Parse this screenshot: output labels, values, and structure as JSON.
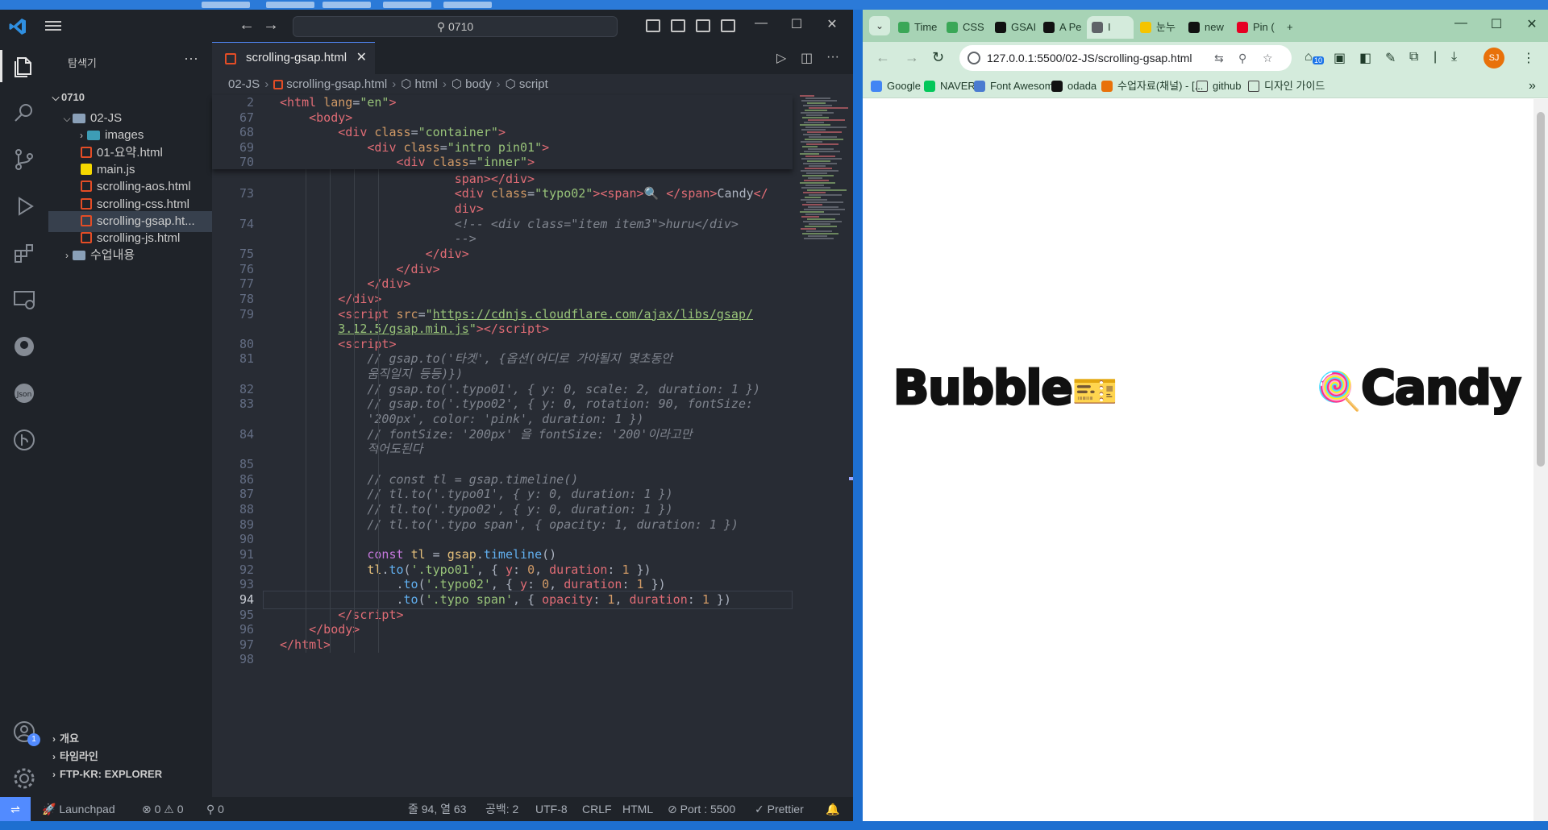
{
  "vscode": {
    "search": "0710",
    "sidebar": {
      "title": "탐색기",
      "workspace": "0710",
      "tree": [
        {
          "label": "02-JS",
          "type": "folder-open"
        },
        {
          "label": "images",
          "type": "folder-img"
        },
        {
          "label": "01-요약.html",
          "type": "html"
        },
        {
          "label": "main.js",
          "type": "js"
        },
        {
          "label": "scrolling-aos.html",
          "type": "html"
        },
        {
          "label": "scrolling-css.html",
          "type": "html"
        },
        {
          "label": "scrolling-gsap.ht...",
          "type": "html",
          "selected": true
        },
        {
          "label": "scrolling-js.html",
          "type": "html"
        },
        {
          "label": "수업내용",
          "type": "folder"
        }
      ],
      "bottom_sections": [
        "개요",
        "타임라인",
        "FTP-KR: EXPLORER"
      ]
    },
    "tab": {
      "label": "scrolling-gsap.html"
    },
    "breadcrumb": [
      "02-JS",
      "scrolling-gsap.html",
      "html",
      "body",
      "script"
    ],
    "accounts_badge": "1",
    "status": {
      "launchpad": "Launchpad",
      "errors": "0",
      "warnings": "0",
      "ports": "0",
      "cursor": "줄 94, 열 63",
      "spaces": "공백: 2",
      "encoding": "UTF-8",
      "eol": "CRLF",
      "language": "HTML",
      "port": "Port : 5500",
      "prettier": "Prettier"
    },
    "code_lines": [
      {
        "n": "2",
        "sticky": true,
        "html": "<span class=\"tag\">&lt;html</span> <span class=\"attr\">lang</span>=<span class=\"str\">\"en\"</span><span class=\"tag\">&gt;</span>"
      },
      {
        "n": "67",
        "sticky": true,
        "html": "    <span class=\"tag\">&lt;body&gt;</span>"
      },
      {
        "n": "68",
        "sticky": true,
        "html": "        <span class=\"tag\">&lt;div</span> <span class=\"attr\">class</span>=<span class=\"str\">\"container\"</span><span class=\"tag\">&gt;</span>"
      },
      {
        "n": "69",
        "sticky": true,
        "html": "            <span class=\"tag\">&lt;div</span> <span class=\"attr\">class</span>=<span class=\"str\">\"intro pin01\"</span><span class=\"tag\">&gt;</span>"
      },
      {
        "n": "70",
        "sticky": true,
        "html": "                <span class=\"tag\">&lt;div</span> <span class=\"attr\">class</span>=<span class=\"str\">\"inner\"</span><span class=\"tag\">&gt;</span>"
      },
      {
        "n": "",
        "html": "                        <span class=\"plain\">span&gt;&lt;/div&gt;</span>"
      },
      {
        "n": "",
        "html": "                        <span class=\"tag\">span&gt;&lt;/div&gt;</span>"
      },
      {
        "n": "73",
        "html": "                        <span class=\"tag\">&lt;div</span> <span class=\"attr\">class</span>=<span class=\"str\">\"typo02\"</span><span class=\"tag\">&gt;&lt;span&gt;</span>🔍 <span class=\"tag\">&lt;/span&gt;</span><span class=\"plain\">Candy</span><span class=\"tag\">&lt;/</span>"
      },
      {
        "n": "",
        "html": "                        <span class=\"tag\">div&gt;</span>"
      },
      {
        "n": "74",
        "html": "                        <span class=\"cmt\">&lt;!-- &lt;div class=\"item item3\"&gt;huru&lt;/div&gt;</span>"
      },
      {
        "n": "",
        "html": "                        <span class=\"cmt\">--&gt;</span>"
      },
      {
        "n": "75",
        "html": "                    <span class=\"tag\">&lt;/div&gt;</span>"
      },
      {
        "n": "76",
        "html": "                <span class=\"tag\">&lt;/div&gt;</span>"
      },
      {
        "n": "77",
        "html": "            <span class=\"tag\">&lt;/div&gt;</span>"
      },
      {
        "n": "78",
        "html": "        <span class=\"tag\">&lt;/div&gt;</span>"
      },
      {
        "n": "79",
        "html": "        <span class=\"tag\">&lt;script</span> <span class=\"attr\">src</span>=<span class=\"str\">\"</span><span class=\"link\">https://cdnjs.cloudflare.com/ajax/libs/gsap/</span>"
      },
      {
        "n": "",
        "html": "        <span class=\"link\">3.12.5/gsap.min.js</span><span class=\"str\">\"</span><span class=\"tag\">&gt;&lt;/script&gt;</span>"
      },
      {
        "n": "80",
        "html": "        <span class=\"tag\">&lt;script&gt;</span>"
      },
      {
        "n": "81",
        "html": "            <span class=\"cmt\">// gsap.to('타겟', {옵션(어디로 가야될지 몇초동안</span>"
      },
      {
        "n": "",
        "html": "            <span class=\"cmt\">움직일지 등등)})</span>"
      },
      {
        "n": "82",
        "html": "            <span class=\"cmt\">// gsap.to('.typo01', { y: 0, scale: 2, duration: 1 })</span>"
      },
      {
        "n": "83",
        "html": "            <span class=\"cmt\">// gsap.to('.typo02', { y: 0, rotation: 90, fontSize:</span>"
      },
      {
        "n": "",
        "html": "            <span class=\"cmt\">'200px', color: 'pink', duration: 1 })</span>"
      },
      {
        "n": "84",
        "html": "            <span class=\"cmt\">// fontSize: '200px' 을 fontSize: '200'이라고만</span>"
      },
      {
        "n": "",
        "html": "            <span class=\"cmt\">적어도된다</span>"
      },
      {
        "n": "85",
        "html": ""
      },
      {
        "n": "86",
        "html": "            <span class=\"cmt\">// const tl = gsap.timeline()</span>"
      },
      {
        "n": "87",
        "html": "            <span class=\"cmt\">// tl.to('.typo01', { y: 0, duration: 1 })</span>"
      },
      {
        "n": "88",
        "html": "            <span class=\"cmt\">// tl.to('.typo02', { y: 0, duration: 1 })</span>"
      },
      {
        "n": "89",
        "html": "            <span class=\"cmt\">// tl.to('.typo span', { opacity: 1, duration: 1 })</span>"
      },
      {
        "n": "90",
        "html": ""
      },
      {
        "n": "91",
        "html": "            <span class=\"kw\">const</span> <span class=\"var\">tl</span> <span class=\"plain\">=</span> <span class=\"var\">gsap</span><span class=\"plain\">.</span><span class=\"fn\">timeline</span><span class=\"plain\">()</span>"
      },
      {
        "n": "92",
        "html": "            <span class=\"var\">tl</span><span class=\"plain\">.</span><span class=\"fn\">to</span><span class=\"plain\">(</span><span class=\"str\">'.typo01'</span><span class=\"plain\">, { </span><span class=\"tag\">y</span><span class=\"plain\">: </span><span class=\"num\">0</span><span class=\"plain\">, </span><span class=\"tag\">duration</span><span class=\"plain\">: </span><span class=\"num\">1</span><span class=\"plain\"> })</span>"
      },
      {
        "n": "93",
        "html": "                <span class=\"plain\">.</span><span class=\"fn\">to</span><span class=\"plain\">(</span><span class=\"str\">'.typo02'</span><span class=\"plain\">, { </span><span class=\"tag\">y</span><span class=\"plain\">: </span><span class=\"num\">0</span><span class=\"plain\">, </span><span class=\"tag\">duration</span><span class=\"plain\">: </span><span class=\"num\">1</span><span class=\"plain\"> })</span>"
      },
      {
        "n": "94",
        "current": true,
        "html": "                <span class=\"plain\">.</span><span class=\"fn\">to</span><span class=\"plain\">(</span><span class=\"str\">'.typo span'</span><span class=\"plain\">, { </span><span class=\"tag\">opacity</span><span class=\"plain\">: </span><span class=\"num\">1</span><span class=\"plain\">, </span><span class=\"tag\">duration</span><span class=\"plain\">: </span><span class=\"num\">1</span><span class=\"plain\"> })</span>"
      },
      {
        "n": "95",
        "html": "        <span class=\"tag\">&lt;/script&gt;</span>"
      },
      {
        "n": "96",
        "html": "    <span class=\"tag\">&lt;/body&gt;</span>"
      },
      {
        "n": "97",
        "html": "<span class=\"tag\">&lt;/html&gt;</span>"
      },
      {
        "n": "98",
        "html": ""
      }
    ]
  },
  "browser": {
    "tabs": [
      {
        "label": "Time",
        "color": "#3aa757"
      },
      {
        "label": "CSS",
        "color": "#3aa757"
      },
      {
        "label": "GSAI",
        "color": "#111111"
      },
      {
        "label": "A Pe",
        "color": "#111111"
      },
      {
        "label": "I",
        "color": "#5f6368",
        "active": true
      },
      {
        "label": "눈누",
        "color": "#f5c400"
      },
      {
        "label": "new",
        "color": "#111111"
      },
      {
        "label": "Pin (",
        "color": "#e60023"
      }
    ],
    "url": "127.0.0.1:5500/02-JS/scrolling-gsap.html",
    "extension_badge": "10",
    "profile": "SJ",
    "bookmarks": [
      {
        "label": "Google",
        "color": "#4285f4"
      },
      {
        "label": "NAVER",
        "color": "#03c75a"
      },
      {
        "label": "Font Awesome",
        "color": "#4a7bd0"
      },
      {
        "label": "odada",
        "color": "#111111"
      },
      {
        "label": "수업자료(채널) - [...",
        "color": "#e8710a"
      },
      {
        "label": "github",
        "folder": true
      },
      {
        "label": "디자인 가이드",
        "folder": true
      }
    ],
    "page": {
      "typo01": "Bubble",
      "typo02": "Candy",
      "typo01_icon": "ticket-emoji",
      "typo02_icon": "lollipop-emoji"
    }
  }
}
